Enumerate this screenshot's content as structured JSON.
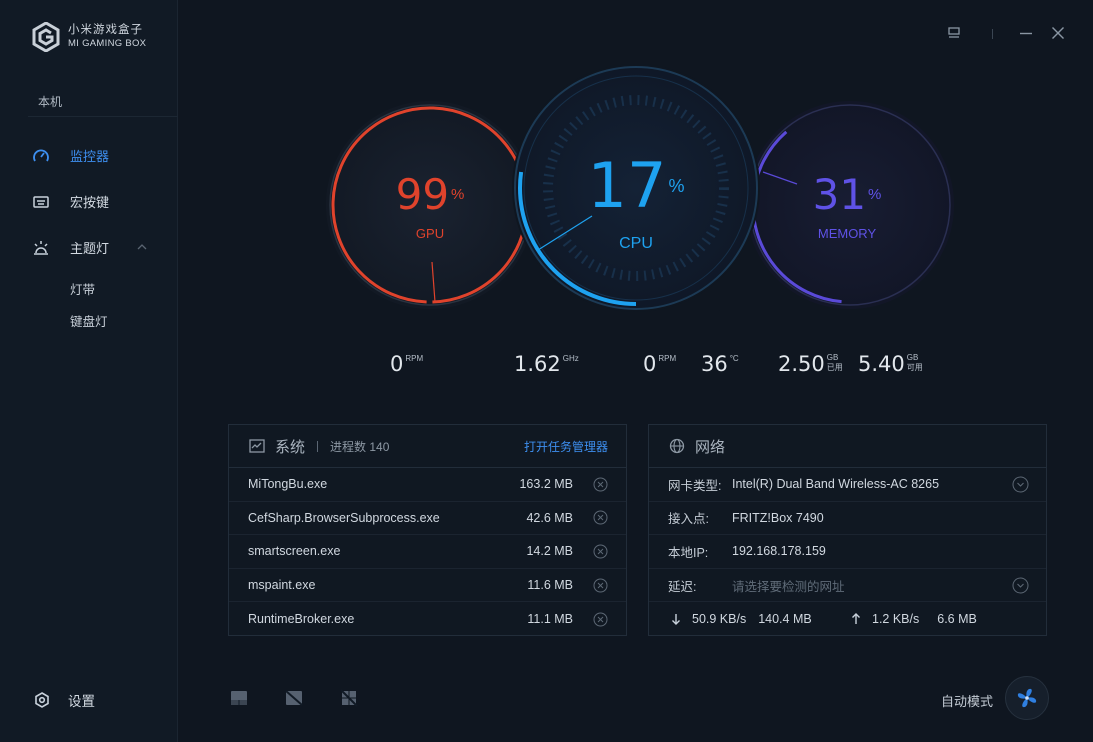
{
  "app": {
    "logo_cn": "小米游戏盒子",
    "logo_en": "MI GAMING BOX"
  },
  "sidebar": {
    "section": "本机",
    "items": [
      {
        "label": "监控器",
        "icon": "gauge-icon",
        "active": true
      },
      {
        "label": "宏按键",
        "icon": "keyboard-icon",
        "active": false
      },
      {
        "label": "主题灯",
        "icon": "light-icon",
        "active": false
      }
    ],
    "subitems": [
      "灯带",
      "键盘灯"
    ],
    "settings": "设置"
  },
  "gauges": {
    "gpu": {
      "value": "99",
      "unit": "%",
      "label": "GPU",
      "color": "#e0432c",
      "percent": 99
    },
    "cpu": {
      "value": "17",
      "unit": "%",
      "label": "CPU",
      "color": "#1ea2f0",
      "percent": 17
    },
    "memory": {
      "value": "31",
      "unit": "%",
      "label": "MEMORY",
      "color": "#5a4ad8",
      "percent": 31
    }
  },
  "stats": {
    "gpu_fan": {
      "value": "0",
      "unit": "RPM"
    },
    "cpu_freq": {
      "value": "1.62",
      "unit": "GHz"
    },
    "cpu_fan": {
      "value": "0",
      "unit": "RPM"
    },
    "cpu_temp": {
      "value": "36",
      "unit": "°C"
    },
    "mem_used": {
      "value": "2.50",
      "unit": "GB",
      "sub": "已用"
    },
    "mem_free": {
      "value": "5.40",
      "unit": "GB",
      "sub": "可用"
    }
  },
  "system": {
    "title": "系统",
    "proc_label": "进程数 140",
    "link": "打开任务管理器",
    "processes": [
      {
        "name": "MiTongBu.exe",
        "mem": "163.2 MB"
      },
      {
        "name": "CefSharp.BrowserSubprocess.exe",
        "mem": "42.6 MB"
      },
      {
        "name": "smartscreen.exe",
        "mem": "14.2 MB"
      },
      {
        "name": "mspaint.exe",
        "mem": "11.6 MB"
      },
      {
        "name": "RuntimeBroker.exe",
        "mem": "11.1 MB"
      }
    ]
  },
  "network": {
    "title": "网络",
    "rows": [
      {
        "label": "网卡类型:",
        "value": "Intel(R) Dual Band Wireless-AC 8265"
      },
      {
        "label": "接入点:",
        "value": "FRITZ!Box 7490"
      },
      {
        "label": "本地IP:",
        "value": "192.168.178.159"
      },
      {
        "label": "延迟:",
        "value": "请选择要检测的网址"
      }
    ],
    "down_rate": "50.9 KB/s",
    "down_total": "140.4 MB",
    "up_rate": "1.2 KB/s",
    "up_total": "6.6 MB"
  },
  "bottom": {
    "auto_mode": "自动模式"
  }
}
